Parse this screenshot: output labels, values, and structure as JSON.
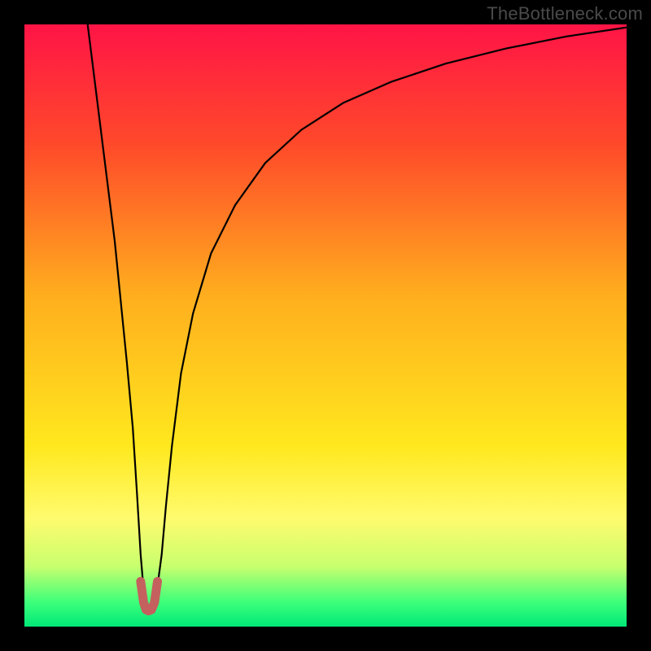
{
  "watermark": "TheBottleneck.com",
  "chart_data": {
    "type": "line",
    "title": "",
    "xlabel": "",
    "ylabel": "",
    "xlim": [
      0,
      100
    ],
    "ylim": [
      0,
      100
    ],
    "grid": false,
    "legend": false,
    "gradient_stops": [
      {
        "offset": 0.0,
        "color": "#ff1446"
      },
      {
        "offset": 0.2,
        "color": "#ff4a2a"
      },
      {
        "offset": 0.45,
        "color": "#ffae1e"
      },
      {
        "offset": 0.7,
        "color": "#ffe81e"
      },
      {
        "offset": 0.82,
        "color": "#fffb6e"
      },
      {
        "offset": 0.9,
        "color": "#c8ff6e"
      },
      {
        "offset": 0.96,
        "color": "#3cff7a"
      },
      {
        "offset": 1.0,
        "color": "#00e878"
      }
    ],
    "series": [
      {
        "name": "curve",
        "stroke": "#000000",
        "stroke_width": 2.2,
        "x": [
          10.5,
          12,
          13.5,
          15,
          16,
          17,
          18,
          18.7,
          19.3,
          19.8,
          20.5,
          21.2,
          22,
          22.8,
          23.5,
          24.5,
          26,
          28,
          31,
          35,
          40,
          46,
          53,
          61,
          70,
          80,
          90,
          100
        ],
        "y": [
          100,
          88,
          76,
          64,
          54,
          44,
          33,
          22,
          12,
          6,
          3,
          3,
          6,
          12,
          20,
          30,
          42,
          52,
          62,
          70,
          77,
          82.5,
          87,
          90.5,
          93.5,
          96,
          98,
          99.5
        ]
      },
      {
        "name": "overlay-dip",
        "stroke": "#c4605e",
        "stroke_width": 11,
        "linecap": "round",
        "x": [
          19.3,
          19.8,
          20.2,
          20.6,
          21.1,
          21.6,
          22.1
        ],
        "y": [
          7.5,
          4.0,
          2.8,
          2.6,
          2.8,
          4.0,
          7.5
        ]
      }
    ]
  }
}
